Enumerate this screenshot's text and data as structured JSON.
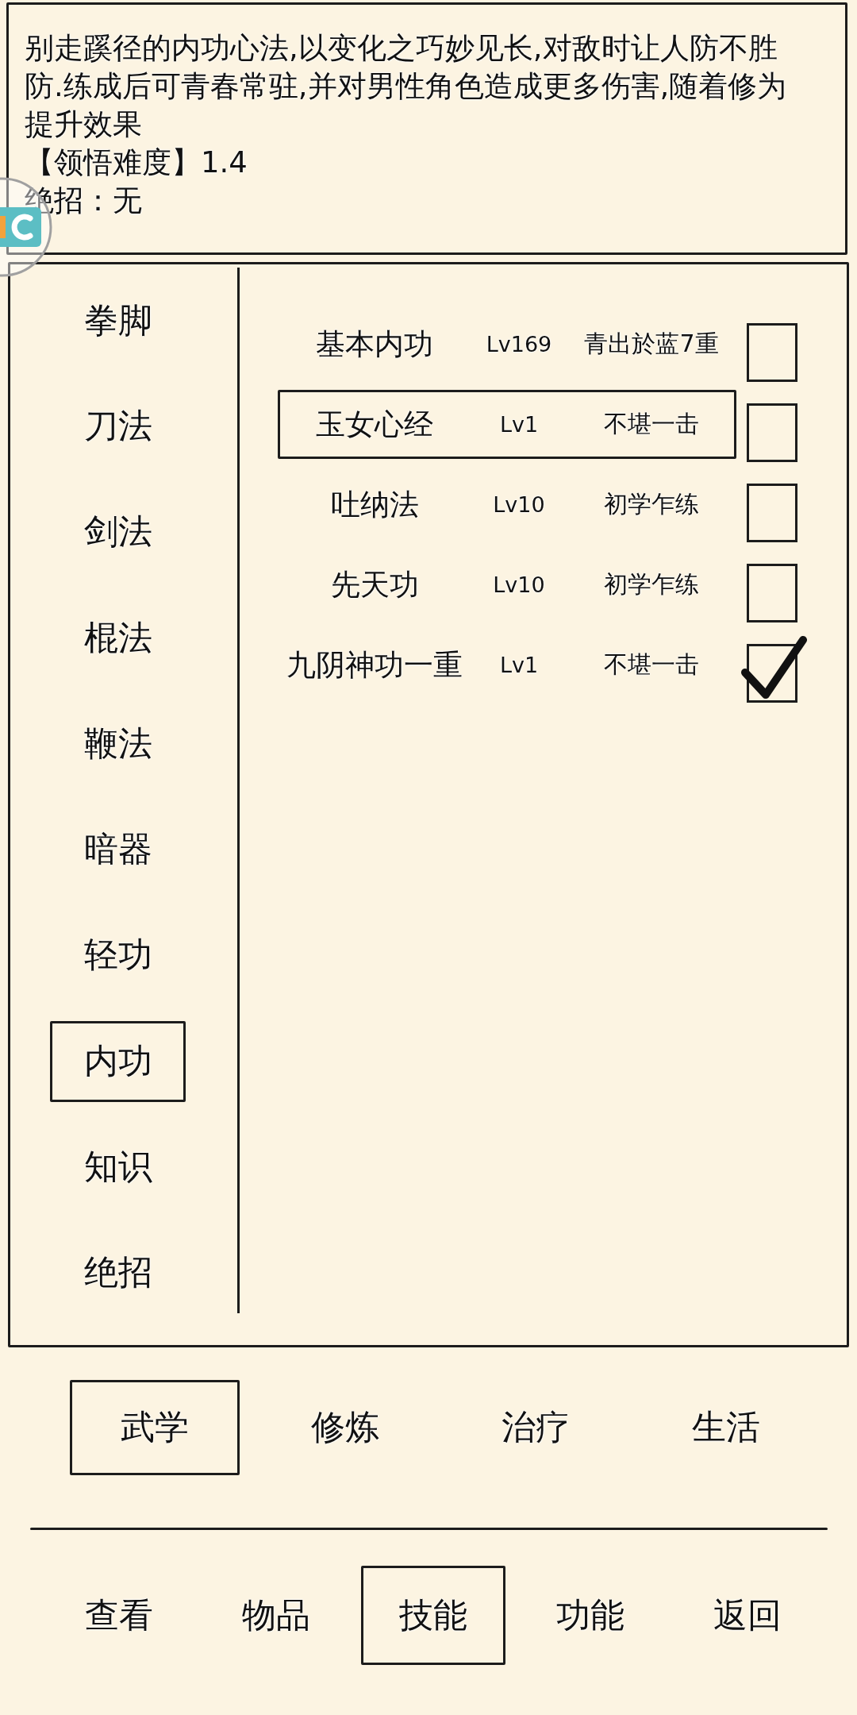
{
  "description": {
    "text": "别走蹊径的内功心法,以变化之巧妙见长,对敌时让人防不胜防.练成后可青春常驻,并对男性角色造成更多伤害,随着修为提升效果",
    "difficulty": "【领悟难度】1.4",
    "ultimate": "绝招：无"
  },
  "categories": [
    {
      "label": "拳脚",
      "selected": false
    },
    {
      "label": "刀法",
      "selected": false
    },
    {
      "label": "剑法",
      "selected": false
    },
    {
      "label": "棍法",
      "selected": false
    },
    {
      "label": "鞭法",
      "selected": false
    },
    {
      "label": "暗器",
      "selected": false
    },
    {
      "label": "轻功",
      "selected": false
    },
    {
      "label": "内功",
      "selected": true
    },
    {
      "label": "知识",
      "selected": false
    },
    {
      "label": "绝招",
      "selected": false
    }
  ],
  "skills": [
    {
      "name": "基本内功",
      "level": "Lv169",
      "rank": "青出於蓝7重",
      "selected": false,
      "checked": false
    },
    {
      "name": "玉女心经",
      "level": "Lv1",
      "rank": "不堪一击",
      "selected": true,
      "checked": false
    },
    {
      "name": "吐纳法",
      "level": "Lv10",
      "rank": "初学乍练",
      "selected": false,
      "checked": false
    },
    {
      "name": "先天功",
      "level": "Lv10",
      "rank": "初学乍练",
      "selected": false,
      "checked": false
    },
    {
      "name": "九阴神功一重",
      "level": "Lv1",
      "rank": "不堪一击",
      "selected": false,
      "checked": true
    }
  ],
  "tabs": [
    {
      "label": "武学",
      "selected": true
    },
    {
      "label": "修炼",
      "selected": false
    },
    {
      "label": "治疗",
      "selected": false
    },
    {
      "label": "生活",
      "selected": false
    }
  ],
  "nav": [
    {
      "label": "查看",
      "selected": false
    },
    {
      "label": "物品",
      "selected": false
    },
    {
      "label": "技能",
      "selected": true
    },
    {
      "label": "功能",
      "selected": false
    },
    {
      "label": "返回",
      "selected": false
    }
  ]
}
